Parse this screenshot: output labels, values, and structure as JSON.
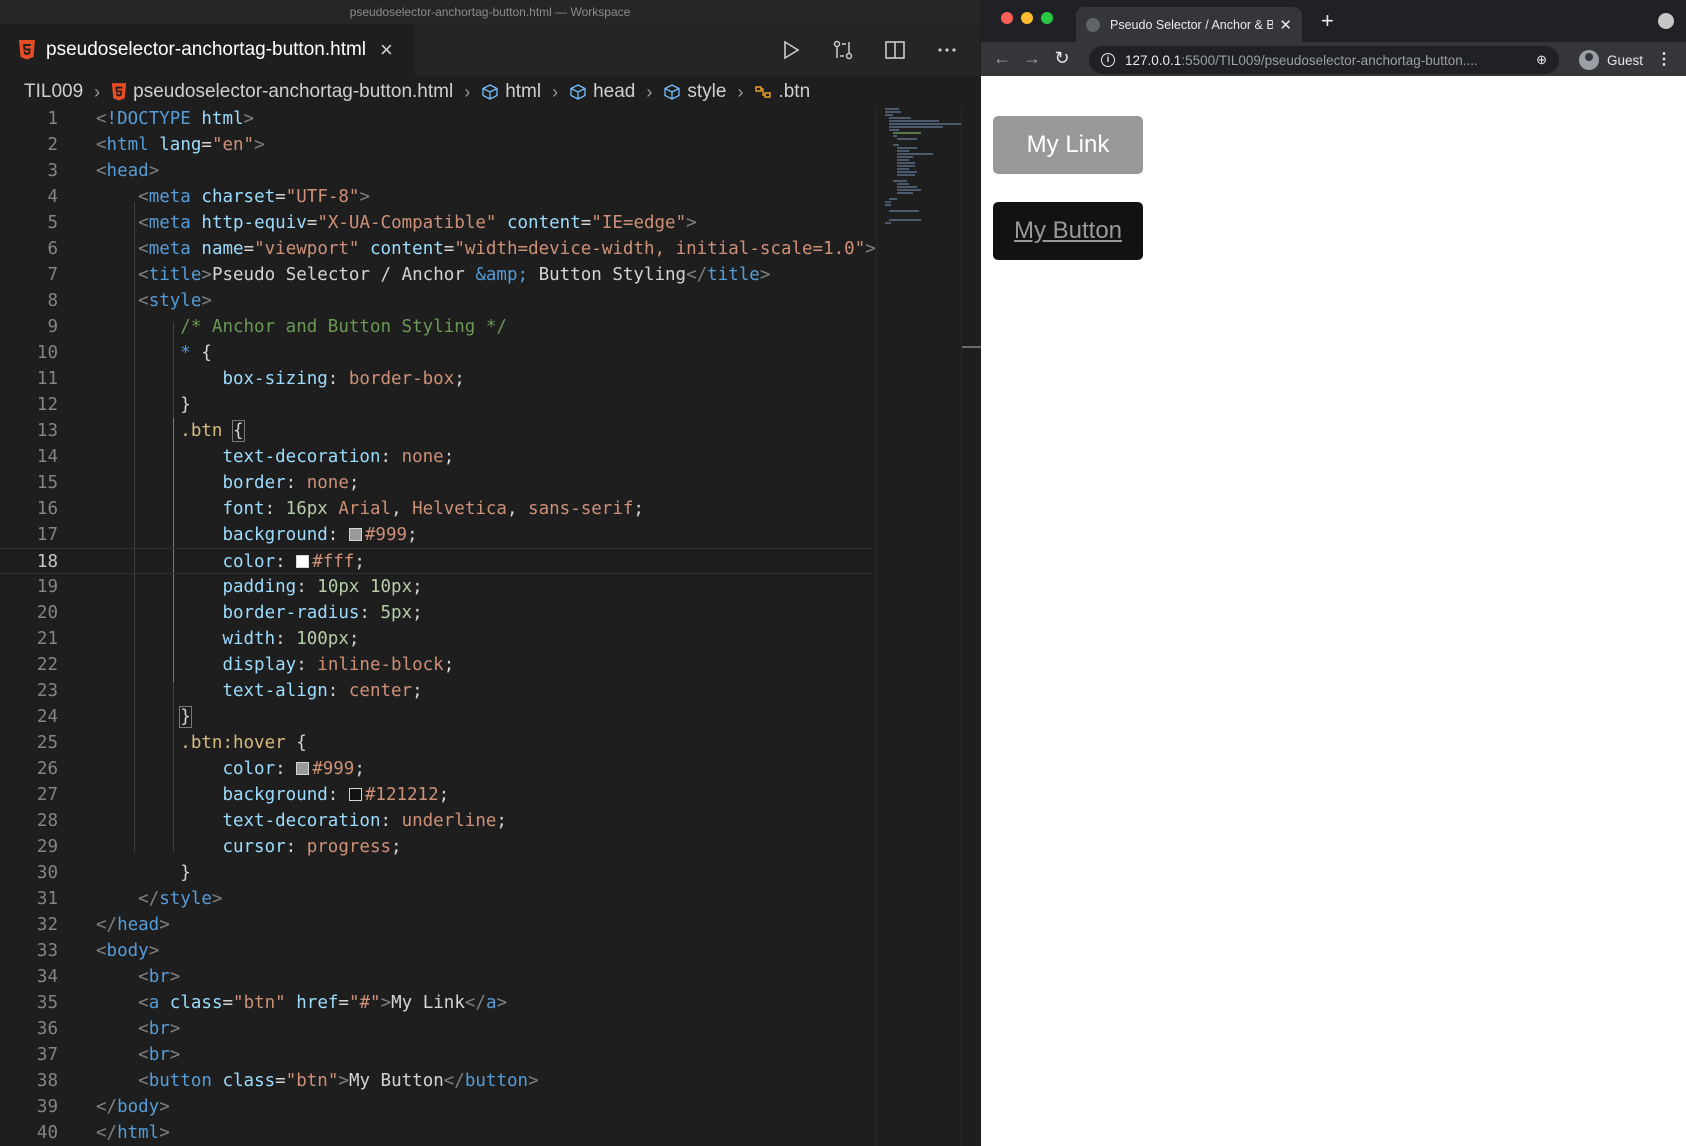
{
  "vscode": {
    "window_title": "pseudoselector-anchortag-button.html — Workspace",
    "tab": {
      "label": "pseudoselector-anchortag-button.html"
    },
    "breadcrumb": [
      "TIL009",
      "pseudoselector-anchortag-button.html",
      "html",
      "head",
      "style",
      ".btn"
    ],
    "current_line": 18,
    "lines": [
      "1",
      "2",
      "3",
      "4",
      "5",
      "6",
      "7",
      "8",
      "9",
      "10",
      "11",
      "12",
      "13",
      "14",
      "15",
      "16",
      "17",
      "18",
      "19",
      "20",
      "21",
      "22",
      "23",
      "24",
      "25",
      "26",
      "27",
      "28",
      "29",
      "30",
      "31",
      "32",
      "33",
      "34",
      "35",
      "36",
      "37",
      "38",
      "39",
      "40"
    ]
  },
  "code": {
    "l1": "<!DOCTYPE html>",
    "comment": "/* Anchor and Button Styling */",
    "title_text_a": "Pseudo Selector / Anchor ",
    "title_entity": "&amp;",
    "title_text_b": " Button Styling",
    "link_text": "My Link",
    "button_text": "My Button"
  },
  "browser": {
    "tab_title": "Pseudo Selector / Anchor & Bu",
    "url_host": "127.0.0.1",
    "url_path": ":5500/TIL009/pseudoselector-anchortag-button....",
    "profile": "Guest",
    "page": {
      "link_label": "My Link",
      "button_label": "My Button"
    }
  },
  "colors": {
    "btn_bg": "#999999",
    "btn_hover_bg": "#121212",
    "editor_bg": "#1e1e1e"
  }
}
